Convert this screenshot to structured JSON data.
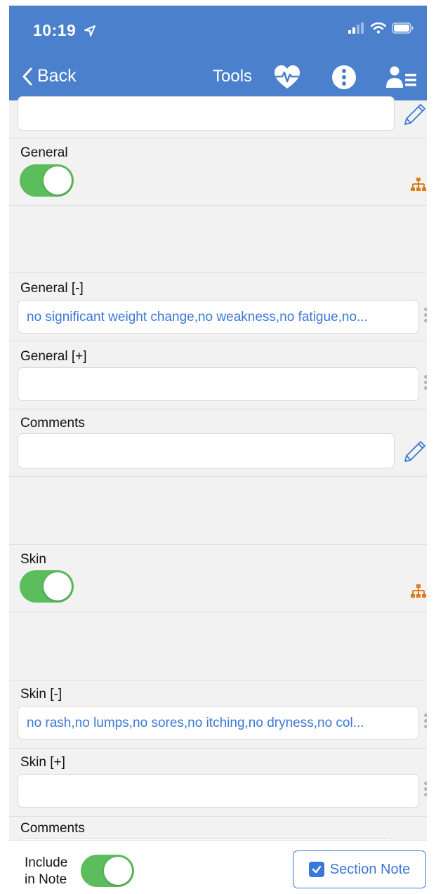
{
  "status": {
    "time": "10:19"
  },
  "nav": {
    "back_label": "Back",
    "title": "Tools"
  },
  "general": {
    "label": "General",
    "neg_label": "General [-]",
    "neg_value": "no significant weight change,no weakness,no fatigue,no...",
    "pos_label": "General [+]",
    "pos_value": "",
    "comments_label": "Comments",
    "comments_value": ""
  },
  "skin": {
    "label": "Skin",
    "neg_label": "Skin [-]",
    "neg_value": "no rash,no lumps,no sores,no itching,no dryness,no col...",
    "pos_label": "Skin [+]",
    "pos_value": "",
    "comments_label": "Comments"
  },
  "footer": {
    "include_line1": "Include",
    "include_line2": "in Note",
    "section_note_label": "Section Note"
  },
  "colors": {
    "header": "#4a80cc",
    "link": "#3a78d8",
    "toggle_on": "#5bbd5b",
    "tree_icon": "#e07b1f"
  },
  "icons": [
    "location-arrow-icon",
    "signal-icon",
    "wifi-icon",
    "battery-icon",
    "chevron-left-icon",
    "heart-pulse-icon",
    "more-icon",
    "user-list-icon",
    "pencil-icon",
    "hierarchy-icon",
    "checkbox-icon"
  ]
}
